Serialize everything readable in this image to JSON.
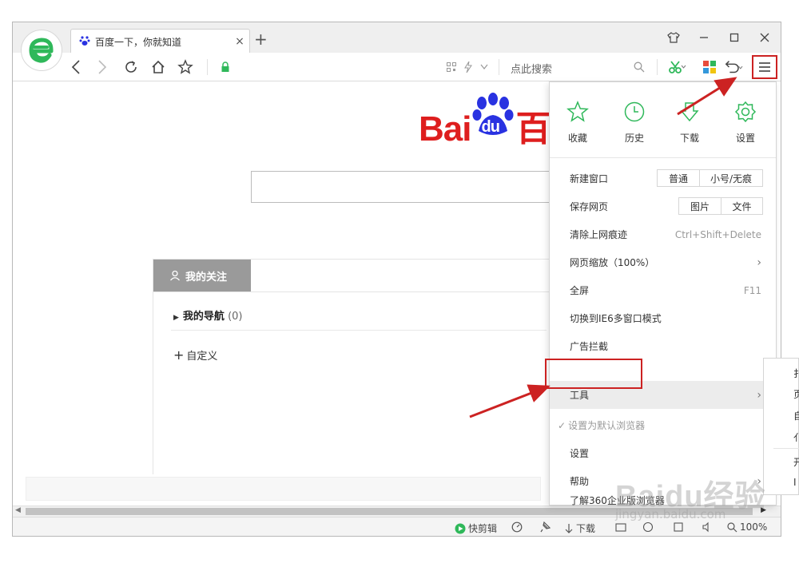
{
  "browser": {
    "tab_title": "百度一下，你就知道",
    "tab_close": "×",
    "new_tab": "+",
    "search_placeholder": "点此搜索"
  },
  "page": {
    "logo_text": "Bai",
    "logo_du": "du",
    "logo_cn": "百",
    "follow_tab": "我的关注",
    "my_nav": "我的导航",
    "my_nav_count": "(0)",
    "custom": "自定义"
  },
  "menu": {
    "top": [
      {
        "label": "收藏",
        "icon": "star-icon"
      },
      {
        "label": "历史",
        "icon": "clock-icon"
      },
      {
        "label": "下载",
        "icon": "download-icon"
      },
      {
        "label": "设置",
        "icon": "gear-icon"
      }
    ],
    "new_window": "新建窗口",
    "new_window_normal": "普通",
    "new_window_small": "小号/无痕",
    "save_page": "保存网页",
    "save_image": "图片",
    "save_file": "文件",
    "clear_history": "清除上网痕迹",
    "clear_shortcut": "Ctrl+Shift+Delete",
    "zoom": "网页缩放（100%）",
    "fullscreen": "全屏",
    "fullscreen_key": "F11",
    "ie6_mode": "切换到IE6多窗口模式",
    "ad_block": "广告拦截",
    "tools": "工具",
    "set_default": "设置为默认浏览器",
    "settings": "设置",
    "help": "帮助",
    "about_enterprise": "了解360企业版浏览器"
  },
  "submenu_letters": [
    "扌",
    "页",
    "自",
    "亻",
    "开",
    "I"
  ],
  "statusbar": {
    "quick_clip": "快剪辑",
    "download": "下载",
    "zoom": "100%"
  },
  "watermark": {
    "main": "Baidu经验",
    "sub": "jingyan.baidu.com"
  },
  "colors": {
    "accent_red": "#cc2222",
    "baidu_red": "#de1e1e",
    "baidu_blue": "#2932e1",
    "green": "#2fb85a"
  }
}
